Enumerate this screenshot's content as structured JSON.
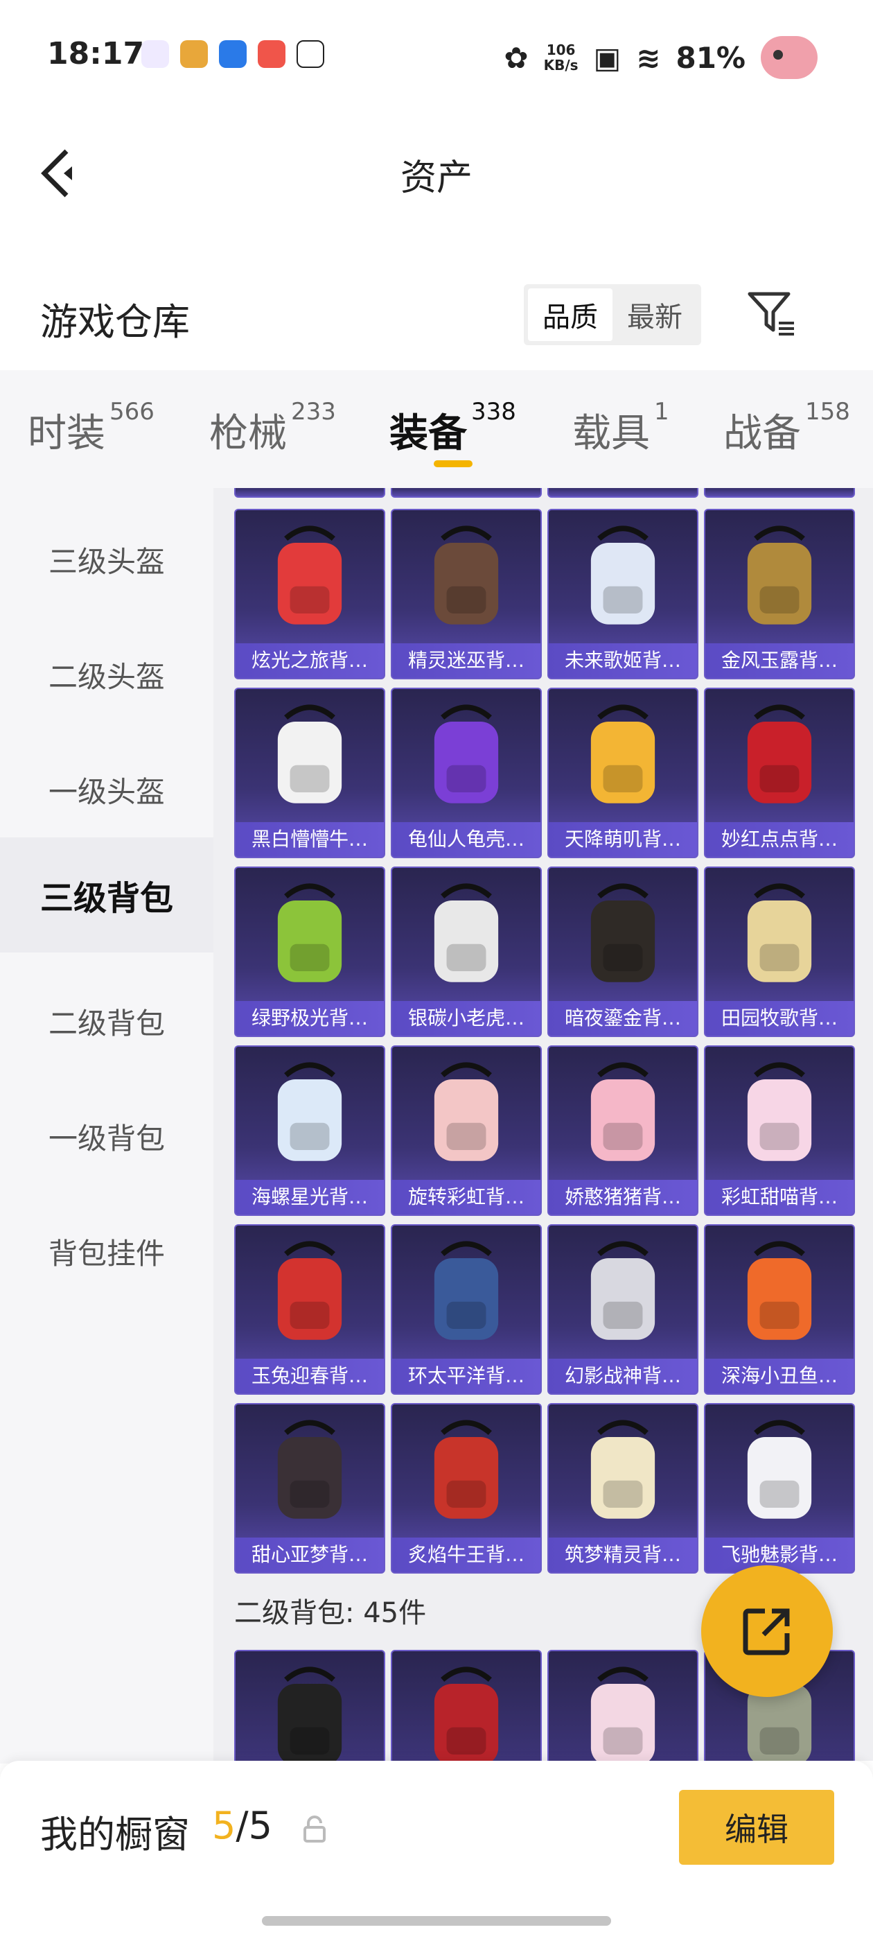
{
  "status_bar": {
    "time": "18:17",
    "speed_value": "106",
    "speed_unit": "KB/s",
    "battery": "81%"
  },
  "header": {
    "title": "资产"
  },
  "warehouse": {
    "label": "游戏仓库",
    "sort_options": [
      "品质",
      "最新"
    ],
    "active_sort": "品质"
  },
  "tabs": [
    {
      "label": "时装",
      "count": "566"
    },
    {
      "label": "枪械",
      "count": "233"
    },
    {
      "label": "装备",
      "count": "338"
    },
    {
      "label": "载具",
      "count": "1"
    },
    {
      "label": "战备",
      "count": "158"
    }
  ],
  "active_tab": "装备",
  "sidebar": [
    {
      "label": "三级头盔"
    },
    {
      "label": "二级头盔"
    },
    {
      "label": "一级头盔"
    },
    {
      "label": "三级背包"
    },
    {
      "label": "二级背包"
    },
    {
      "label": "一级背包"
    },
    {
      "label": "背包挂件"
    }
  ],
  "active_sidebar": "三级背包",
  "items": [
    {
      "name": "炫光之旅背…",
      "color": "#e23b3b",
      "icon": "monster-backpack-icon"
    },
    {
      "name": "精灵迷巫背…",
      "color": "#6b4a3a",
      "icon": "leather-backpack-icon"
    },
    {
      "name": "未来歌姬背…",
      "color": "#dfe7f5",
      "icon": "idol-backpack-icon"
    },
    {
      "name": "金风玉露背…",
      "color": "#b08a3c",
      "icon": "golden-backpack-icon"
    },
    {
      "name": "黑白懵懵牛…",
      "color": "#f2f2f2",
      "icon": "cow-backpack-icon"
    },
    {
      "name": "龟仙人龟壳…",
      "color": "#7b3fd6",
      "icon": "turtle-shell-icon"
    },
    {
      "name": "天降萌叽背…",
      "color": "#f3b534",
      "icon": "yellow-backpack-icon"
    },
    {
      "name": "妙红点点背…",
      "color": "#c9202a",
      "icon": "ladybug-backpack-icon"
    },
    {
      "name": "绿野极光背…",
      "color": "#8cc43a",
      "icon": "green-backpack-icon"
    },
    {
      "name": "银碳小老虎…",
      "color": "#e8e8e8",
      "icon": "tiger-backpack-icon"
    },
    {
      "name": "暗夜鎏金背…",
      "color": "#2f2a26",
      "icon": "dark-gold-backpack-icon"
    },
    {
      "name": "田园牧歌背…",
      "color": "#e7d49a",
      "icon": "basket-backpack-icon"
    },
    {
      "name": "海螺星光背…",
      "color": "#dce9f8",
      "icon": "pouch-backpack-icon"
    },
    {
      "name": "旋转彩虹背…",
      "color": "#f3c6c6",
      "icon": "carousel-backpack-icon"
    },
    {
      "name": "娇憨猪猪背…",
      "color": "#f5b7c8",
      "icon": "pig-backpack-icon"
    },
    {
      "name": "彩虹甜喵背…",
      "color": "#f7d6e6",
      "icon": "cat-backpack-icon"
    },
    {
      "name": "玉兔迎春背…",
      "color": "#d3332f",
      "icon": "rabbit-backpack-icon"
    },
    {
      "name": "环太平洋背…",
      "color": "#3a5a9a",
      "icon": "mecha-backpack-icon"
    },
    {
      "name": "幻影战神背…",
      "color": "#d8d8e0",
      "icon": "tech-backpack-icon"
    },
    {
      "name": "深海小丑鱼…",
      "color": "#ef6a2a",
      "icon": "clownfish-backpack-icon"
    },
    {
      "name": "甜心亚梦背…",
      "color": "#3a3036",
      "icon": "quilted-backpack-icon"
    },
    {
      "name": "炙焰牛王背…",
      "color": "#c8342a",
      "icon": "flame-bull-backpack-icon"
    },
    {
      "name": "筑梦精灵背…",
      "color": "#f0e6c6",
      "icon": "fairy-backpack-icon"
    },
    {
      "name": "飞驰魅影背…",
      "color": "#f2f2f6",
      "icon": "racer-backpack-icon"
    }
  ],
  "section_title": "二级背包: 45件",
  "next_items": [
    {
      "color": "#222222",
      "icon": "dog-backpack-icon"
    },
    {
      "color": "#b8232a",
      "icon": "red-mask-backpack-icon"
    },
    {
      "color": "#f3d7e3",
      "icon": "bunny-backpack-icon"
    },
    {
      "color": "#9aa08a",
      "icon": "robot-backpack-icon"
    }
  ],
  "showcase": {
    "label": "我的橱窗",
    "current": "5",
    "separator": "/",
    "total": "5",
    "edit_label": "编辑"
  },
  "colors": {
    "accent": "#f2b21f",
    "card_purple": "#5b4bc4"
  }
}
